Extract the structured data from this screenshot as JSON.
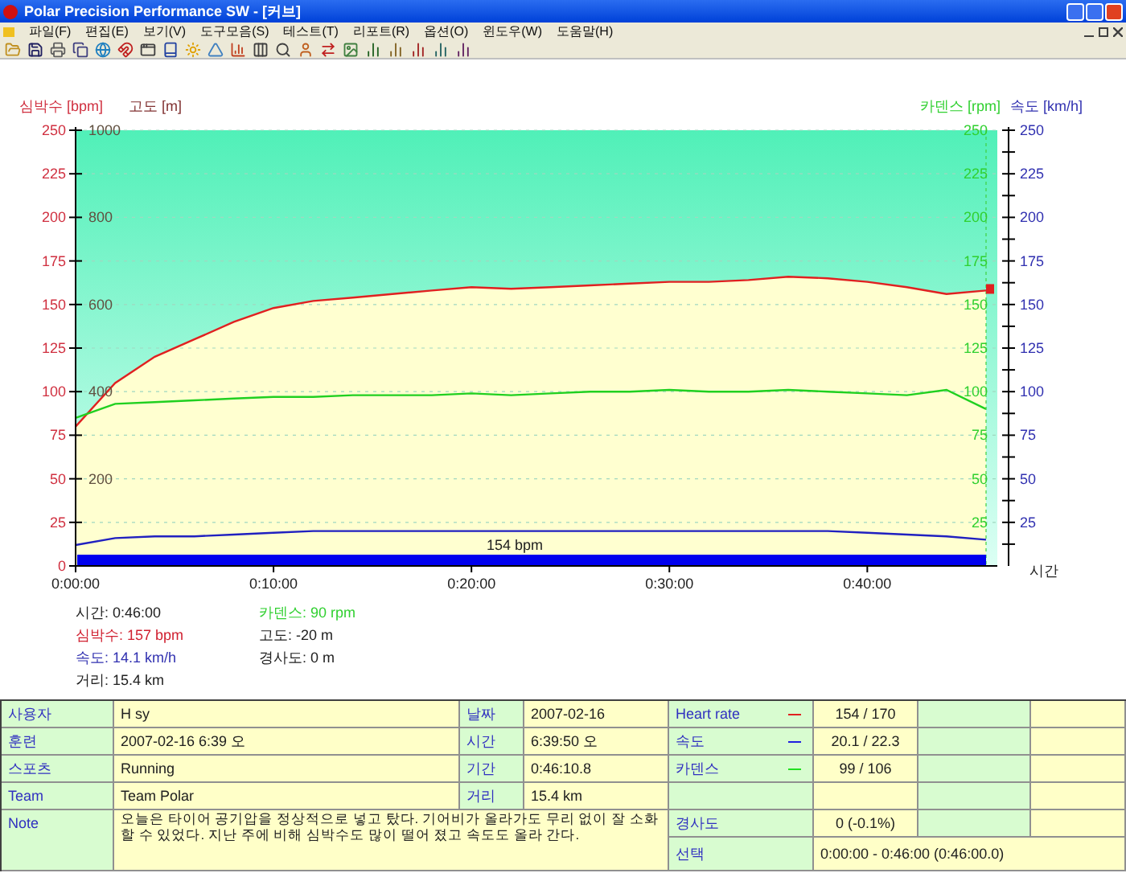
{
  "window": {
    "title": "Polar Precision Performance SW - [커브]"
  },
  "menu": [
    "파일(F)",
    "편집(E)",
    "보기(V)",
    "도구모음(S)",
    "테스트(T)",
    "리포트(R)",
    "옵션(O)",
    "윈도우(W)",
    "도움말(H)"
  ],
  "chart": {
    "chart_data": {
      "type": "line",
      "xlabel": "시간",
      "ylabel": "심박수 [bpm]",
      "x": [
        0,
        2,
        4,
        6,
        8,
        10,
        12,
        14,
        16,
        18,
        20,
        22,
        24,
        26,
        28,
        30,
        32,
        34,
        36,
        38,
        40,
        42,
        44,
        46
      ],
      "series": [
        {
          "color": "#e02020",
          "values": [
            80,
            105,
            120,
            130,
            140,
            148,
            152,
            154,
            156,
            158,
            160,
            159,
            160,
            161,
            162,
            163,
            163,
            164,
            166,
            165,
            163,
            160,
            156,
            158
          ]
        },
        {
          "color": "#20d020",
          "values": [
            85,
            93,
            94,
            95,
            96,
            97,
            97,
            98,
            98,
            98,
            99,
            98,
            99,
            100,
            100,
            101,
            100,
            100,
            101,
            100,
            99,
            98,
            101,
            90
          ]
        },
        {
          "color": "#2020c0",
          "values": [
            12,
            16,
            17,
            17,
            18,
            19,
            20,
            20,
            20,
            20,
            20,
            20,
            20,
            20,
            20,
            20,
            20,
            20,
            20,
            20,
            19,
            18,
            17,
            15
          ]
        }
      ],
      "xlim": [
        0,
        46
      ],
      "ylim": [
        0,
        250
      ],
      "grid": true,
      "xticks": [
        {
          "value": 0,
          "label": "0:00:00"
        },
        {
          "value": 10,
          "label": "0:10:00"
        },
        {
          "value": 20,
          "label": "0:20:00"
        },
        {
          "value": 30,
          "label": "0:30:00"
        },
        {
          "value": 40,
          "label": "0:40:00"
        }
      ],
      "yticks": [
        0,
        25,
        50,
        75,
        100,
        125,
        150,
        175,
        200,
        225,
        250
      ]
    },
    "altitude_axis": {
      "label": "고도 [m]",
      "ticks": [
        "1000",
        "800",
        "600",
        "400",
        "200"
      ]
    },
    "cadence_axis": {
      "label": "카덴스 [rpm]",
      "ticks": [
        "250",
        "225",
        "200",
        "175",
        "150",
        "125",
        "100",
        "75",
        "50",
        "25"
      ]
    },
    "speed_axis": {
      "label": "속도 [km/h]",
      "ticks": [
        "250",
        "225",
        "200",
        "175",
        "150",
        "125",
        "100",
        "75",
        "50",
        "25"
      ]
    },
    "band_label": "154 bpm"
  },
  "readings": [
    {
      "label": "시간:",
      "value": "0:46:00",
      "color": "#202020"
    },
    {
      "label": "심박수:",
      "value": "157 bpm",
      "color": "#d02030"
    },
    {
      "label": "속도:",
      "value": "14.1 km/h",
      "color": "#3030b0"
    },
    {
      "label": "거리:",
      "value": "15.4 km",
      "color": "#202020"
    },
    {
      "label": "카덴스:",
      "value": "90 rpm",
      "color": "#30d030"
    },
    {
      "label": "고도:",
      "value": "-20 m",
      "color": "#202020"
    },
    {
      "label": "경사도:",
      "value": "0 m",
      "color": "#202020"
    }
  ],
  "info": {
    "rows": [
      {
        "label": "사용자",
        "value": "H sy",
        "label2": "날짜",
        "value2": "2007-02-16"
      },
      {
        "label": "훈련",
        "value": "2007-02-16 6:39 오",
        "label2": "시간",
        "value2": "6:39:50 오"
      },
      {
        "label": "스포츠",
        "value": "Running",
        "label2": "기간",
        "value2": "0:46:10.8"
      },
      {
        "label": "Team",
        "value": "Team Polar",
        "label2": "거리",
        "value2": "15.4 km"
      }
    ],
    "metrics": [
      {
        "label": "Heart rate",
        "color": "#e02020",
        "value": "154 / 170"
      },
      {
        "label": "속도",
        "color": "#2020e0",
        "value": "20.1 / 22.3"
      },
      {
        "label": "카덴스",
        "color": "#20e020",
        "value": "99 / 106"
      }
    ],
    "note": {
      "label": "Note",
      "text": "오늘은 타이어 공기압을 정상적으로 넣고 탔다. 기어비가 올라가도 무리 없이 잘 소화 할 수 있었다. 지난 주에 비해 심박수도 많이 떨어 졌고 속도도 올라 간다."
    },
    "slope": {
      "label": "경사도",
      "value": "0 (-0.1%)"
    },
    "selection": {
      "label": "선택",
      "value": "0:00:00 - 0:46:00 (0:46:00.0)"
    }
  }
}
